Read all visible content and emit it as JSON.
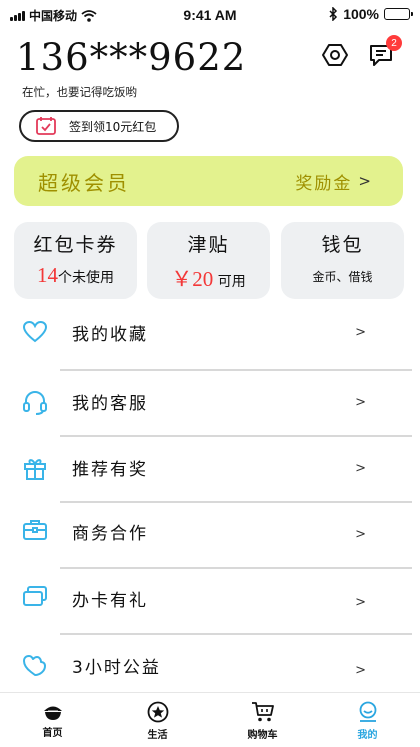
{
  "status_bar": {
    "carrier": "中国移动",
    "time": "9:41 AM",
    "battery": "100%"
  },
  "header": {
    "phone": "136***9622",
    "motto": "在忙，也要记得吃饭哟",
    "message_badge": "2"
  },
  "signin": {
    "label": "签到领10元红包"
  },
  "vip": {
    "title": "超级会员",
    "reward": "奖励金",
    "chevron": ">"
  },
  "cards": [
    {
      "title": "红包卡券",
      "count": "14",
      "suffix": "个未使用"
    },
    {
      "title": "津贴",
      "amount": "￥20",
      "suffix": " 可用"
    },
    {
      "title": "钱包",
      "sub": "金币、借钱"
    }
  ],
  "menu": [
    {
      "label": "我的收藏",
      "icon": "heart-icon",
      "chevron": ">"
    },
    {
      "label": "我的客服",
      "icon": "headset-icon",
      "chevron": ">"
    },
    {
      "label": "推荐有奖",
      "icon": "gift-icon",
      "chevron": ">"
    },
    {
      "label": "商务合作",
      "icon": "briefcase-icon",
      "chevron": ">"
    },
    {
      "label": "办卡有礼",
      "icon": "cards-icon",
      "chevron": ">"
    },
    {
      "label": "3小时公益",
      "icon": "hand-heart-icon",
      "chevron": ">"
    }
  ],
  "tabs": [
    {
      "label": "首页",
      "icon": "home-icon"
    },
    {
      "label": "生活",
      "icon": "star-icon"
    },
    {
      "label": "购物车",
      "icon": "cart-icon"
    },
    {
      "label": "我的",
      "icon": "profile-icon",
      "active": true
    }
  ],
  "colors": {
    "accent": "#2aa6e0",
    "vip_bg": "#e3f28e",
    "vip_text": "#9f9000",
    "highlight_red": "#f33838"
  }
}
